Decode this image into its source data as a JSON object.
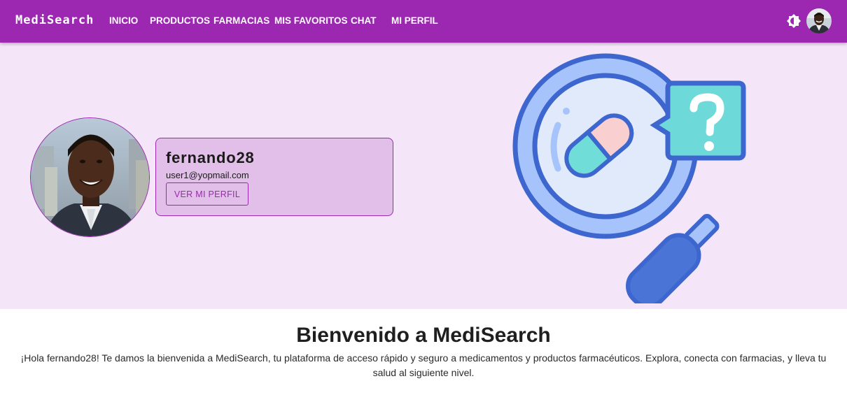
{
  "app": {
    "brand": "MediSearch"
  },
  "nav": {
    "items": [
      {
        "label": "INICIO"
      },
      {
        "label": "PRODUCTOS"
      },
      {
        "label": "FARMACIAS"
      },
      {
        "label": "MIS FAVORITOS"
      },
      {
        "label": "CHAT"
      },
      {
        "label": "MI PERFIL"
      }
    ],
    "theme_toggle_icon": "brightness-icon",
    "avatar_icon": "user-avatar"
  },
  "profile": {
    "username": "fernando28",
    "email": "user1@yopmail.com",
    "button_label": "VER MI PERFIL"
  },
  "hero": {
    "illustration": "magnifier-pill-question-icon"
  },
  "welcome": {
    "title": "Bienvenido a MediSearch",
    "text": "¡Hola fernando28! Te damos la bienvenida a MediSearch, tu plataforma de acceso rápido y seguro a medicamentos y productos farmacéuticos. Explora, conecta con farmacias, y lleva tu salud al siguiente nivel."
  },
  "colors": {
    "primary": "#9c27b0",
    "hero_bg": "#f4e6f8",
    "card_bg": "#e1bfe8"
  }
}
